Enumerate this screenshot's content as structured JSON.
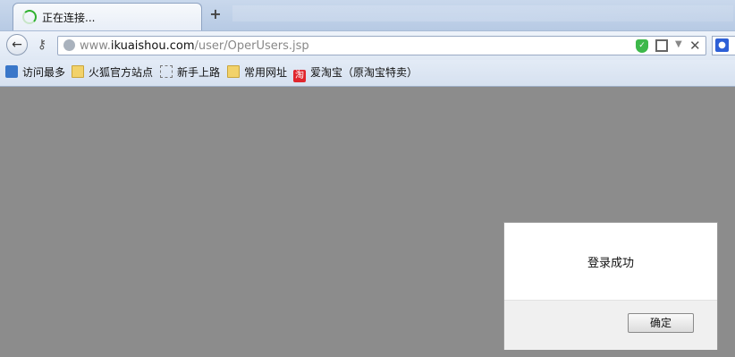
{
  "tab": {
    "title": "正在连接...",
    "close_glyph": "✕"
  },
  "newtab_glyph": "+",
  "nav": {
    "back_glyph": "←",
    "url_prefix": "www.",
    "url_host": "ikuaishou.com",
    "url_path": "/user/OperUsers.jsp"
  },
  "bookmarks": [
    {
      "label": "访问最多",
      "icon": "most-visited-icon"
    },
    {
      "label": "火狐官方站点",
      "icon": "folder-icon"
    },
    {
      "label": "新手上路",
      "icon": "dashed-box-icon"
    },
    {
      "label": "常用网址",
      "icon": "folder-icon"
    },
    {
      "label": "爱淘宝（原淘宝特卖）",
      "icon": "taobao-icon",
      "icon_text": "淘"
    }
  ],
  "dialog": {
    "message": "登录成功",
    "ok_label": "确定"
  },
  "colors": {
    "page_overlay": "#8c8c8c",
    "shield": "#3db84a",
    "taobao": "#e0262d"
  }
}
